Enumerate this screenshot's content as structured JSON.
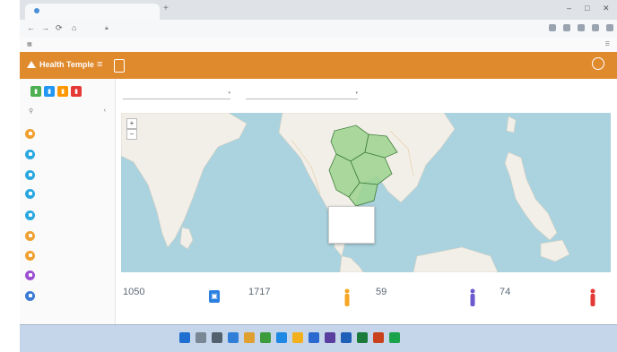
{
  "browser": {
    "tab_title": "",
    "url": "",
    "bookmarks_label": ""
  },
  "header": {
    "app_name": "Health Temple",
    "menu_icon": "hamburger-icon",
    "home_button": "",
    "user_lines": [
      "",
      ""
    ]
  },
  "sidebar": {
    "tile_colors": [
      "#4caf50",
      "#2196f3",
      "#ff9800",
      "#e53935"
    ],
    "items": [
      {
        "label": "",
        "color": "#f0a030"
      },
      {
        "label": "",
        "color": "#29a8e0"
      },
      {
        "label": "",
        "color": "#29a8e0"
      },
      {
        "label": "",
        "color": "#29a8e0"
      },
      {
        "label": "",
        "color": "#29a8e0"
      },
      {
        "label": "",
        "color": "#f0a030"
      },
      {
        "label": "",
        "color": "#f0a030"
      },
      {
        "label": "",
        "color": "#9c4fd1"
      },
      {
        "label": "",
        "color": "#3a7bd5"
      }
    ]
  },
  "filters": [
    {
      "value": ""
    },
    {
      "value": ""
    }
  ],
  "map": {
    "zoom_in": "+",
    "zoom_out": "−",
    "popup_lines": [
      "",
      "",
      "",
      "",
      ""
    ],
    "attribution": ""
  },
  "stats": [
    {
      "value": "1050",
      "label": "",
      "icon": "building-icon",
      "icon_color": "#2a7fe0"
    },
    {
      "value": "1717",
      "label": "",
      "icon": "person-icon",
      "icon_color": "#f5a623"
    },
    {
      "value": "59",
      "label": "",
      "icon": "person-icon",
      "icon_color": "#6a5acd"
    },
    {
      "value": "74",
      "label": "",
      "icon": "person-icon",
      "icon_color": "#e53935"
    }
  ],
  "taskbar": {
    "clock": ""
  }
}
